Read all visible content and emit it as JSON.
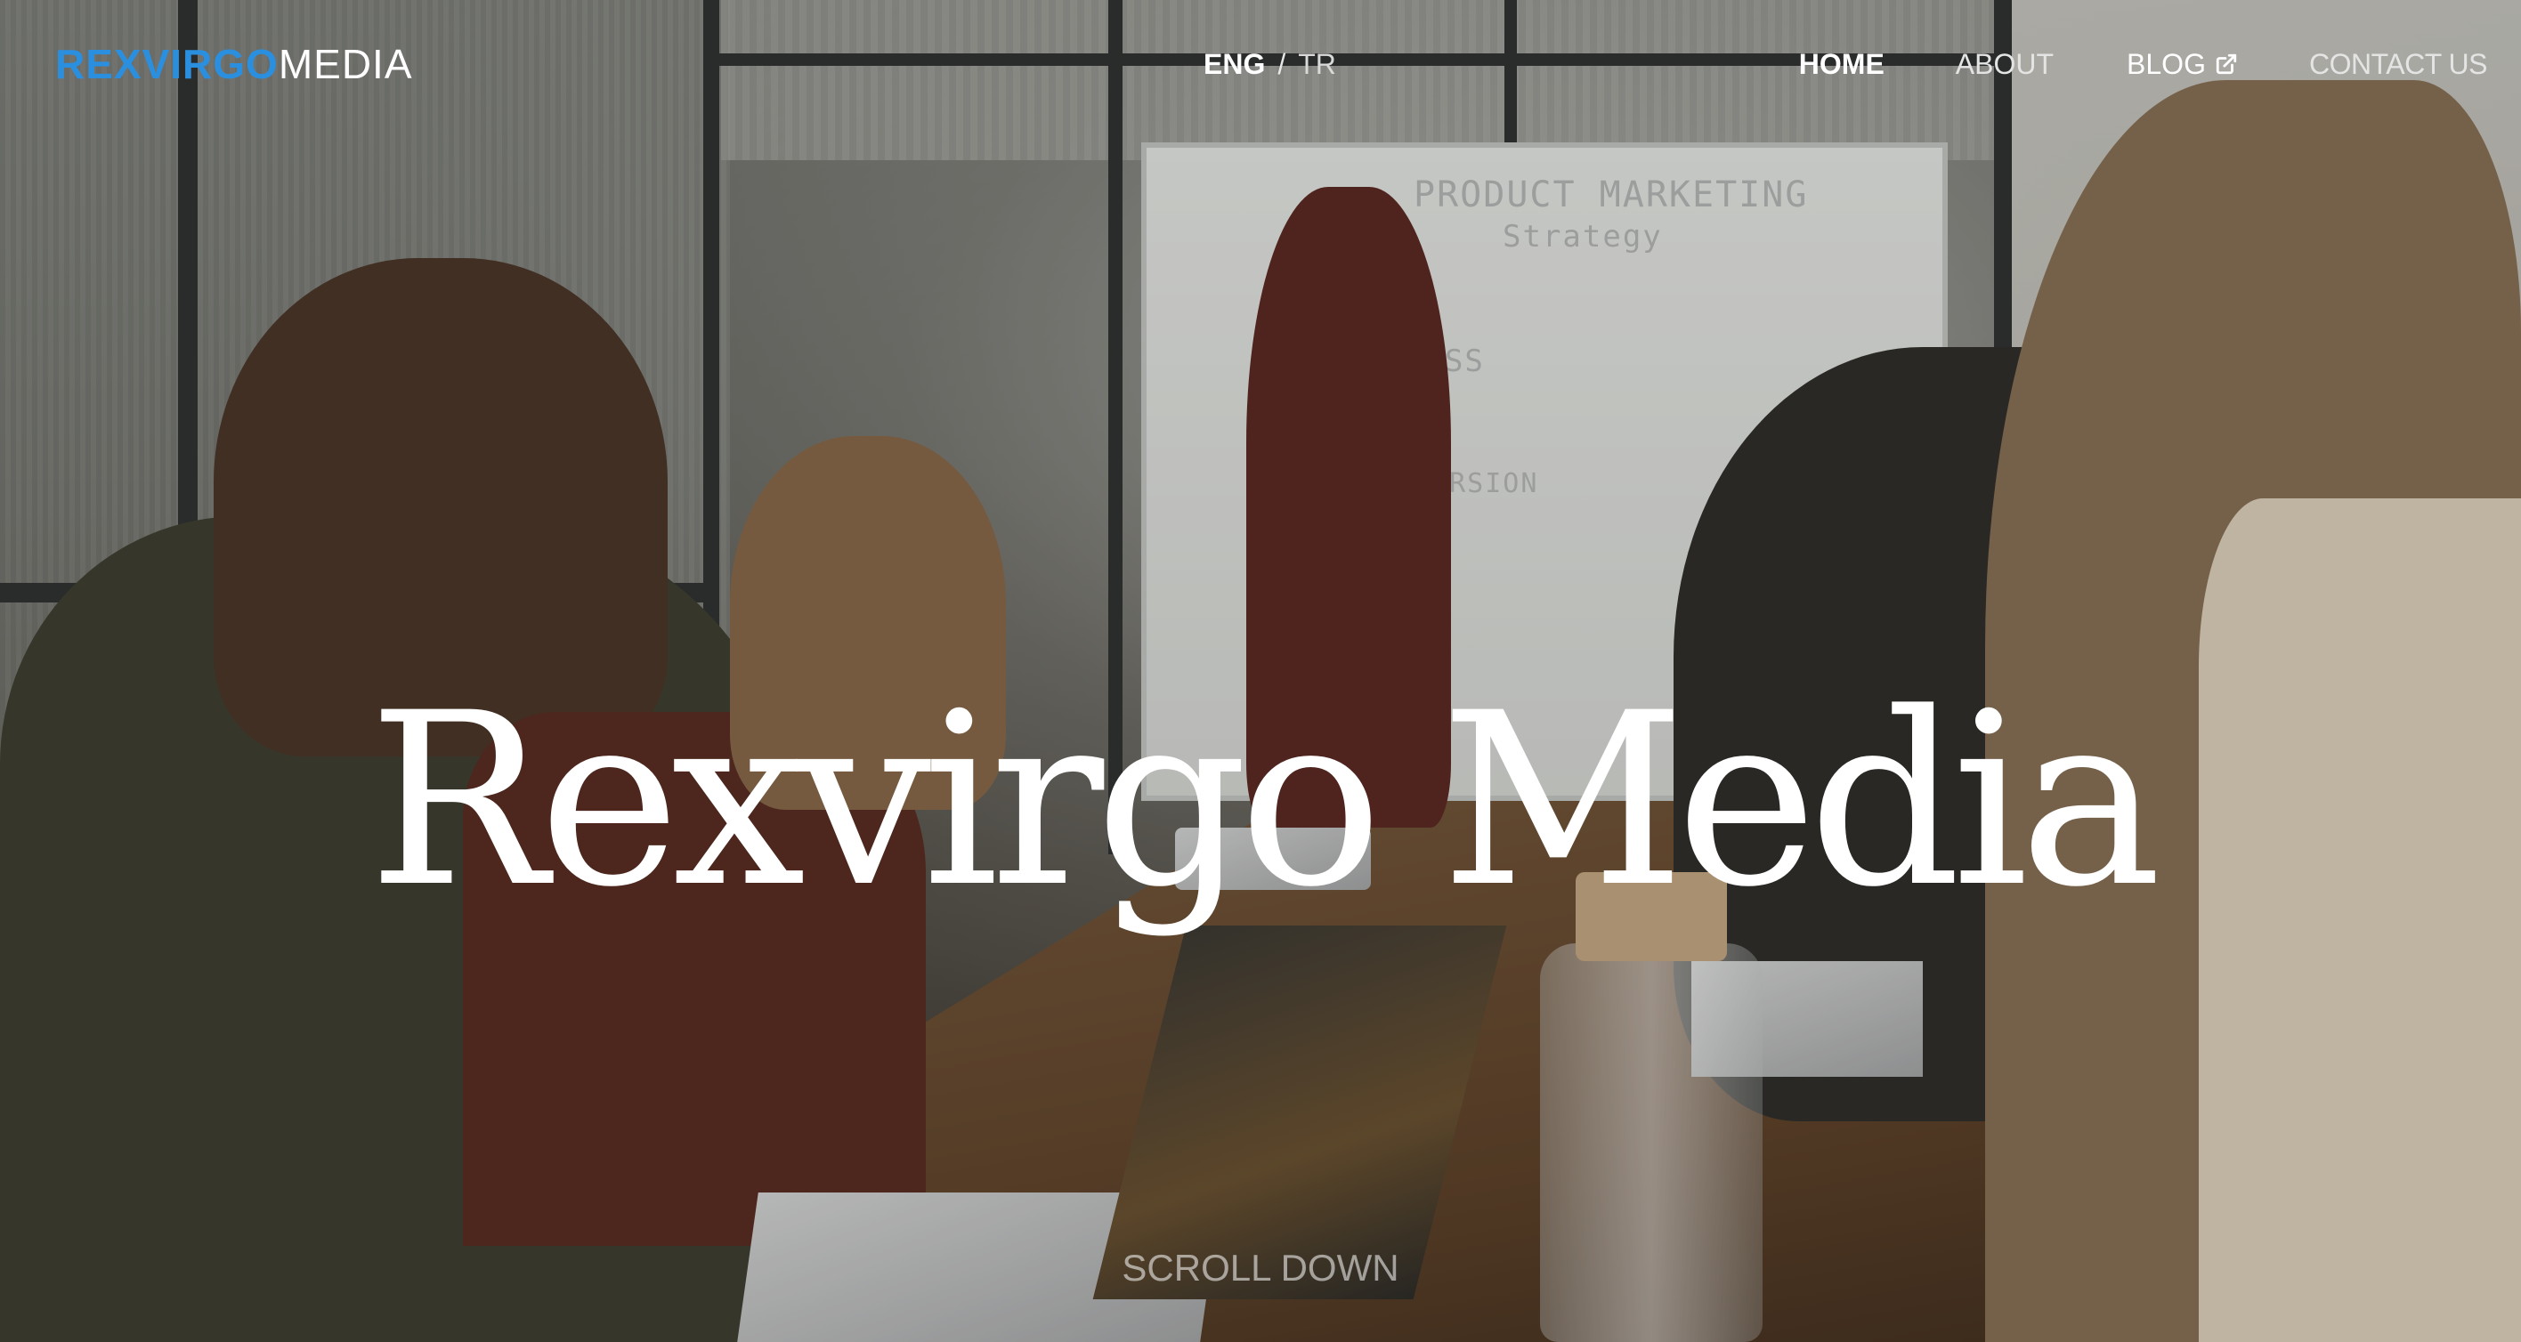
{
  "header": {
    "logo": {
      "bold": "REXVIRGO",
      "light": "MEDIA"
    },
    "languages": {
      "active": "ENG",
      "separator": "/",
      "other": "TR"
    },
    "nav": {
      "home": "HOME",
      "about": "ABOUT",
      "blog": "BLOG",
      "blog_icon": "external-link-icon",
      "contact": "CONTACT US"
    }
  },
  "hero": {
    "title": "Rexvirgo Media",
    "scroll_hint": "SCROLL DOWN"
  },
  "colors": {
    "brand_blue": "#2b8fe0",
    "text_white": "#ffffff"
  }
}
